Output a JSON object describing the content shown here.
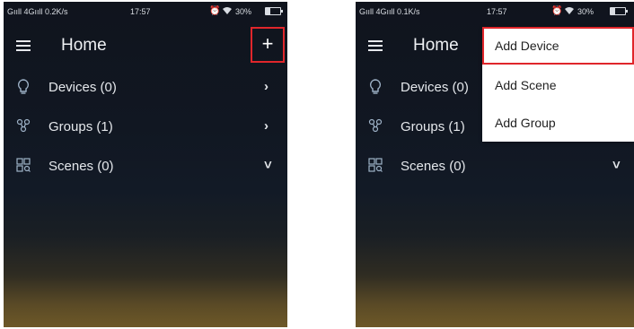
{
  "screens": {
    "left": {
      "status": {
        "signal": "Gııll 4Gııll 0.2K/s",
        "time": "17:57",
        "battery_pct": "30%"
      },
      "appbar": {
        "title": "Home",
        "add_button": "+"
      },
      "rows": [
        {
          "icon": "lightbulb-icon",
          "label": "Devices (0)",
          "chevron": "›"
        },
        {
          "icon": "groups-icon",
          "label": "Groups (1)",
          "chevron": "›"
        },
        {
          "icon": "scenes-icon",
          "label": "Scenes (0)",
          "chevron": "˅"
        }
      ]
    },
    "right": {
      "status": {
        "signal": "Gııll 4Gııll 0.1K/s",
        "time": "17:57",
        "battery_pct": "30%"
      },
      "appbar": {
        "title": "Home"
      },
      "rows": [
        {
          "icon": "lightbulb-icon",
          "label": "Devices (0)"
        },
        {
          "icon": "groups-icon",
          "label": "Groups (1)"
        },
        {
          "icon": "scenes-icon",
          "label": "Scenes (0)",
          "chevron": "˅"
        }
      ],
      "dropdown": {
        "items": [
          "Add Device",
          "Add Scene",
          "Add Group"
        ],
        "highlighted": "Add Device"
      }
    }
  },
  "colors": {
    "highlight": "#e0262b",
    "text": "#e4e7eb",
    "icon": "#9fb3c8",
    "dropdown_bg": "#ffffff"
  }
}
